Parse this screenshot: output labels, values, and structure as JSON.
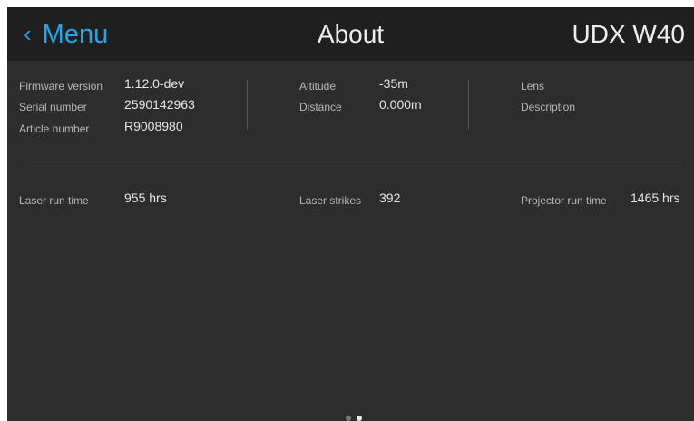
{
  "header": {
    "back_icon": "chevron-left-icon",
    "back_label": "Menu",
    "title": "About",
    "model": "UDX W40"
  },
  "device_info": [
    {
      "label": "Firmware version",
      "value": "1.12.0-dev"
    },
    {
      "label": "Serial number",
      "value": "2590142963"
    },
    {
      "label": "Article number",
      "value": "R9008980"
    }
  ],
  "position_info": [
    {
      "label": "Altitude",
      "value": "-35m"
    },
    {
      "label": "Distance",
      "value": "0.000m"
    }
  ],
  "lens_info": [
    {
      "label": "Lens",
      "value": ""
    },
    {
      "label": "Description",
      "value": ""
    }
  ],
  "run_times": [
    {
      "label": "Laser run time",
      "value": "955 hrs"
    },
    {
      "label": "Laser strikes",
      "value": "392"
    },
    {
      "label": "Projector run time",
      "value": "1465 hrs"
    }
  ],
  "pagination": {
    "pages": 2,
    "current": 2
  },
  "colors": {
    "accent": "#2aa4e8",
    "background": "#2d2d2d",
    "header": "#1f1f1f"
  }
}
